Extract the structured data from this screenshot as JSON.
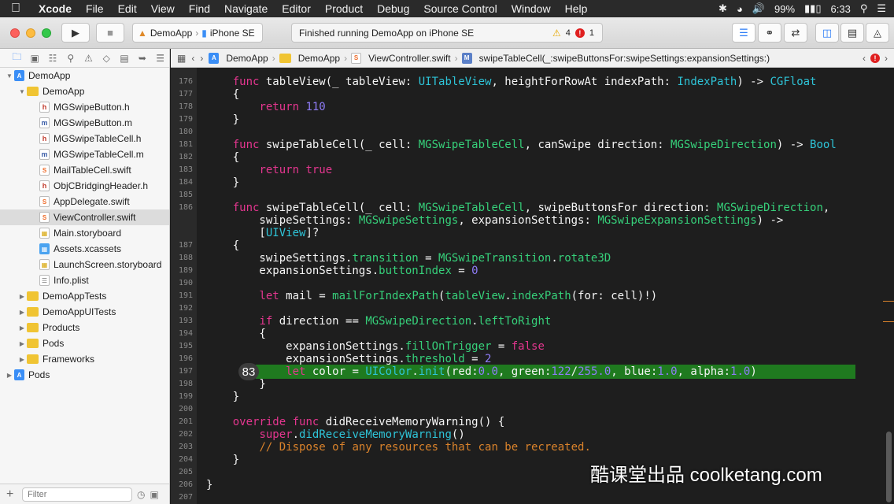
{
  "menubar": {
    "items": [
      "Xcode",
      "File",
      "Edit",
      "View",
      "Find",
      "Navigate",
      "Editor",
      "Product",
      "Debug",
      "Source Control",
      "Window",
      "Help"
    ],
    "battery": "99%",
    "time": "6:33"
  },
  "toolbar": {
    "scheme_app": "DemoApp",
    "scheme_device": "iPhone SE",
    "activity_text": "Finished running DemoApp on iPhone SE",
    "warning_count": "4",
    "error_count": "1"
  },
  "navigator": {
    "filter_placeholder": "Filter",
    "items": [
      {
        "label": "DemoApp",
        "icon": "proj",
        "indent": 0,
        "disclosure": "open"
      },
      {
        "label": "DemoApp",
        "icon": "folder",
        "indent": 1,
        "disclosure": "open"
      },
      {
        "label": "MGSwipeButton.h",
        "icon": "h",
        "indent": 2,
        "disclosure": ""
      },
      {
        "label": "MGSwipeButton.m",
        "icon": "m",
        "indent": 2,
        "disclosure": ""
      },
      {
        "label": "MGSwipeTableCell.h",
        "icon": "h",
        "indent": 2,
        "disclosure": ""
      },
      {
        "label": "MGSwipeTableCell.m",
        "icon": "m",
        "indent": 2,
        "disclosure": ""
      },
      {
        "label": "MailTableCell.swift",
        "icon": "swift",
        "indent": 2,
        "disclosure": ""
      },
      {
        "label": "ObjCBridgingHeader.h",
        "icon": "h",
        "indent": 2,
        "disclosure": ""
      },
      {
        "label": "AppDelegate.swift",
        "icon": "swift",
        "indent": 2,
        "disclosure": ""
      },
      {
        "label": "ViewController.swift",
        "icon": "swift",
        "indent": 2,
        "disclosure": "",
        "selected": true
      },
      {
        "label": "Main.storyboard",
        "icon": "sb",
        "indent": 2,
        "disclosure": ""
      },
      {
        "label": "Assets.xcassets",
        "icon": "assets",
        "indent": 2,
        "disclosure": ""
      },
      {
        "label": "LaunchScreen.storyboard",
        "icon": "sb",
        "indent": 2,
        "disclosure": ""
      },
      {
        "label": "Info.plist",
        "icon": "plist",
        "indent": 2,
        "disclosure": ""
      },
      {
        "label": "DemoAppTests",
        "icon": "folder",
        "indent": 1,
        "disclosure": "closed"
      },
      {
        "label": "DemoAppUITests",
        "icon": "folder",
        "indent": 1,
        "disclosure": "closed"
      },
      {
        "label": "Products",
        "icon": "folder",
        "indent": 1,
        "disclosure": "closed"
      },
      {
        "label": "Pods",
        "icon": "folder",
        "indent": 1,
        "disclosure": "closed"
      },
      {
        "label": "Frameworks",
        "icon": "folder",
        "indent": 1,
        "disclosure": "closed"
      },
      {
        "label": "Pods",
        "icon": "proj",
        "indent": 0,
        "disclosure": "closed"
      }
    ]
  },
  "jumpbar": {
    "crumbs": [
      "DemoApp",
      "DemoApp",
      "ViewController.swift",
      "swipeTableCell(_:swipeButtonsFor:swipeSettings:expansionSettings:)"
    ]
  },
  "editor": {
    "highlight_line": "197",
    "bubble_value": "83",
    "lines": [
      {
        "n": "176",
        "t": [
          [
            "    ",
            ""
          ],
          [
            "func",
            "kw"
          ],
          [
            " tableView(_ tableView: ",
            ""
          ],
          [
            "UITableView",
            "ty"
          ],
          [
            ", heightForRowAt indexPath: ",
            ""
          ],
          [
            "IndexPath",
            "ty"
          ],
          [
            ") -> ",
            ""
          ],
          [
            "CGFloat",
            "ty"
          ]
        ]
      },
      {
        "n": "177",
        "t": [
          [
            "    {",
            ""
          ]
        ]
      },
      {
        "n": "178",
        "t": [
          [
            "        ",
            ""
          ],
          [
            "return",
            "kw"
          ],
          [
            " ",
            ""
          ],
          [
            "110",
            "num"
          ]
        ]
      },
      {
        "n": "179",
        "t": [
          [
            "    }",
            ""
          ]
        ]
      },
      {
        "n": "180",
        "t": []
      },
      {
        "n": "181",
        "t": [
          [
            "    ",
            ""
          ],
          [
            "func",
            "kw"
          ],
          [
            " swipeTableCell(_ cell: ",
            ""
          ],
          [
            "MGSwipeTableCell",
            "fn"
          ],
          [
            ", canSwipe direction: ",
            ""
          ],
          [
            "MGSwipeDirection",
            "fn"
          ],
          [
            ") -> ",
            ""
          ],
          [
            "Bool",
            "ty"
          ]
        ]
      },
      {
        "n": "182",
        "t": [
          [
            "    {",
            ""
          ]
        ]
      },
      {
        "n": "183",
        "t": [
          [
            "        ",
            ""
          ],
          [
            "return",
            "kw"
          ],
          [
            " ",
            ""
          ],
          [
            "true",
            "kw"
          ]
        ]
      },
      {
        "n": "184",
        "t": [
          [
            "    }",
            ""
          ]
        ]
      },
      {
        "n": "185",
        "t": []
      },
      {
        "n": "186",
        "t": [
          [
            "    ",
            ""
          ],
          [
            "func",
            "kw"
          ],
          [
            " swipeTableCell(_ cell: ",
            ""
          ],
          [
            "MGSwipeTableCell",
            "fn"
          ],
          [
            ", swipeButtonsFor direction: ",
            ""
          ],
          [
            "MGSwipeDirection",
            "fn"
          ],
          [
            ",",
            ""
          ]
        ]
      },
      {
        "n": "",
        "t": [
          [
            "        swipeSettings: ",
            ""
          ],
          [
            "MGSwipeSettings",
            "fn"
          ],
          [
            ", expansionSettings: ",
            ""
          ],
          [
            "MGSwipeExpansionSettings",
            "fn"
          ],
          [
            ") ->",
            ""
          ]
        ]
      },
      {
        "n": "",
        "t": [
          [
            "        [",
            ""
          ],
          [
            "UIView",
            "ty"
          ],
          [
            "]?",
            ""
          ]
        ]
      },
      {
        "n": "187",
        "t": [
          [
            "    {",
            ""
          ]
        ]
      },
      {
        "n": "188",
        "t": [
          [
            "        swipeSettings.",
            ""
          ],
          [
            "transition",
            "fn"
          ],
          [
            " = ",
            ""
          ],
          [
            "MGSwipeTransition",
            "fn"
          ],
          [
            ".",
            ""
          ],
          [
            "rotate3D",
            "fn"
          ]
        ]
      },
      {
        "n": "189",
        "t": [
          [
            "        expansionSettings.",
            ""
          ],
          [
            "buttonIndex",
            "fn"
          ],
          [
            " = ",
            ""
          ],
          [
            "0",
            "num"
          ]
        ]
      },
      {
        "n": "190",
        "t": []
      },
      {
        "n": "191",
        "t": [
          [
            "        ",
            ""
          ],
          [
            "let",
            "kw"
          ],
          [
            " mail = ",
            ""
          ],
          [
            "mailForIndexPath",
            "fn"
          ],
          [
            "(",
            ""
          ],
          [
            "tableView",
            "fn"
          ],
          [
            ".",
            ""
          ],
          [
            "indexPath",
            "fn"
          ],
          [
            "(for: cell)!)",
            ""
          ]
        ]
      },
      {
        "n": "192",
        "t": []
      },
      {
        "n": "193",
        "t": [
          [
            "        ",
            ""
          ],
          [
            "if",
            "kw"
          ],
          [
            " direction == ",
            ""
          ],
          [
            "MGSwipeDirection",
            "fn"
          ],
          [
            ".",
            ""
          ],
          [
            "leftToRight",
            "fn"
          ]
        ]
      },
      {
        "n": "194",
        "t": [
          [
            "        {",
            ""
          ]
        ]
      },
      {
        "n": "195",
        "t": [
          [
            "            expansionSettings.",
            ""
          ],
          [
            "fillOnTrigger",
            "fn"
          ],
          [
            " = ",
            ""
          ],
          [
            "false",
            "kw"
          ]
        ]
      },
      {
        "n": "196",
        "t": [
          [
            "            expansionSettings.",
            ""
          ],
          [
            "threshold",
            "fn"
          ],
          [
            " = ",
            ""
          ],
          [
            "2",
            "num"
          ]
        ]
      },
      {
        "n": "197",
        "t": [
          [
            "            ",
            ""
          ],
          [
            "let",
            "kw"
          ],
          [
            " color = ",
            ""
          ],
          [
            "UIColor",
            "ty"
          ],
          [
            ".",
            ""
          ],
          [
            "init",
            "ty"
          ],
          [
            "(red:",
            ""
          ],
          [
            "0.0",
            "num"
          ],
          [
            ", green:",
            ""
          ],
          [
            "122",
            "num"
          ],
          [
            "/",
            ""
          ],
          [
            "255.0",
            "num"
          ],
          [
            ", blue:",
            ""
          ],
          [
            "1.0",
            "num"
          ],
          [
            ", alpha:",
            ""
          ],
          [
            "1.0",
            "num"
          ],
          [
            ")",
            ""
          ]
        ]
      },
      {
        "n": "198",
        "t": [
          [
            "        }",
            ""
          ]
        ]
      },
      {
        "n": "199",
        "t": [
          [
            "    }",
            ""
          ]
        ]
      },
      {
        "n": "200",
        "t": []
      },
      {
        "n": "201",
        "t": [
          [
            "    ",
            ""
          ],
          [
            "override",
            "kw"
          ],
          [
            " ",
            ""
          ],
          [
            "func",
            "kw"
          ],
          [
            " didReceiveMemoryWarning() {",
            ""
          ]
        ]
      },
      {
        "n": "202",
        "t": [
          [
            "        ",
            ""
          ],
          [
            "super",
            "kw"
          ],
          [
            ".",
            ""
          ],
          [
            "didReceiveMemoryWarning",
            "ty"
          ],
          [
            "()",
            ""
          ]
        ]
      },
      {
        "n": "203",
        "t": [
          [
            "        ",
            ""
          ],
          [
            "// Dispose of any resources that can be recreated.",
            "cm"
          ]
        ]
      },
      {
        "n": "204",
        "t": [
          [
            "    }",
            ""
          ]
        ]
      },
      {
        "n": "205",
        "t": []
      },
      {
        "n": "206",
        "t": [
          [
            "}",
            ""
          ]
        ]
      },
      {
        "n": "207",
        "t": []
      }
    ]
  },
  "watermark": "酷课堂出品 coolketang.com"
}
